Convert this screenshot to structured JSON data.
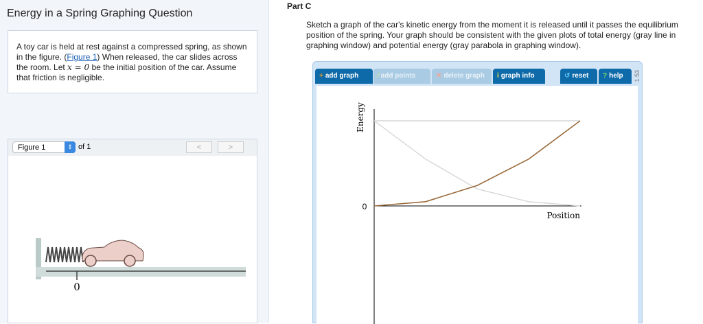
{
  "left": {
    "title": "Energy in a Spring Graphing Question",
    "problem": {
      "p1": "A toy car is held at rest against a compressed spring, as shown in the figure. (",
      "link": "Figure 1",
      "p2": ") When released, the car slides across the room. Let ",
      "var": "x = 0",
      "p3": " be the initial position of the car. Assume that friction is negligible."
    },
    "figure": {
      "selected": "Figure 1",
      "of": "of 1",
      "prev": "<",
      "next": ">",
      "axis_label": "0"
    }
  },
  "right": {
    "part": "Part C",
    "instructions": "Sketch a graph of the car's kinetic energy from the moment it is released until it passes the equilibrium position of the spring. Your graph should be consistent with the given plots of total energy (gray line in graphing window) and potential energy (gray parabola in graphing window).",
    "toolbar": {
      "add_graph": "add graph",
      "add_points": "add points",
      "delete_graph": "delete graph",
      "graph_info": "graph info",
      "reset": "reset",
      "help": "help",
      "version": "1.53"
    }
  },
  "chart_data": {
    "type": "line",
    "xlabel": "Position",
    "ylabel": "Energy",
    "y_tick": "0",
    "xlim": [
      0,
      4
    ],
    "ylim": [
      0,
      2
    ],
    "series": [
      {
        "name": "Total energy",
        "color": "#d6d6d6",
        "x": [
          0,
          4
        ],
        "y": [
          2,
          2
        ]
      },
      {
        "name": "Potential energy",
        "color": "#d6d6d6",
        "x": [
          0,
          1,
          2,
          3,
          4
        ],
        "y": [
          2,
          1.1,
          0.4,
          0.1,
          0
        ]
      },
      {
        "name": "Kinetic energy",
        "color": "#9a6a3a",
        "x": [
          0,
          1,
          2,
          3,
          4
        ],
        "y": [
          0,
          0.1,
          0.48,
          1.1,
          2
        ]
      }
    ]
  }
}
